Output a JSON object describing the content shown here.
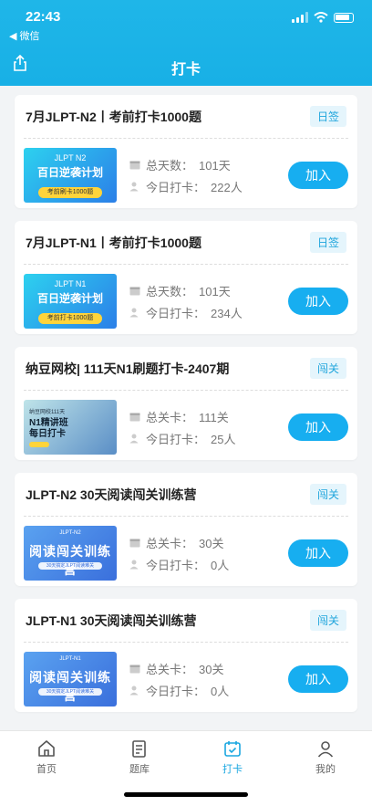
{
  "status_bar": {
    "time": "22:43",
    "back_app": "◀ 微信"
  },
  "header": {
    "title": "打卡"
  },
  "cards": [
    {
      "title": "7月JLPT-N2丨考前打卡1000题",
      "tag": "日签",
      "stat1_label": "总天数：",
      "stat1_value": "101天",
      "stat2_label": "今日打卡：",
      "stat2_value": "222人",
      "thumb": {
        "line1": "JLPT N2",
        "line2": "百日逆袭计划",
        "pill": "考前刷卡1000题"
      },
      "join": "加入"
    },
    {
      "title": "7月JLPT-N1丨考前打卡1000题",
      "tag": "日签",
      "stat1_label": "总天数：",
      "stat1_value": "101天",
      "stat2_label": "今日打卡：",
      "stat2_value": "234人",
      "thumb": {
        "line1": "JLPT N1",
        "line2": "百日逆袭计划",
        "pill": "考前打卡1000题"
      },
      "join": "加入"
    },
    {
      "title": "纳豆网校| 111天N1刷题打卡-2407期",
      "tag": "闯关",
      "stat1_label": "总关卡：",
      "stat1_value": "111关",
      "stat2_label": "今日打卡：",
      "stat2_value": "25人",
      "thumb": {
        "line1": "纳豆网校111天",
        "line2": "N1精讲班",
        "line3": "每日打卡"
      },
      "join": "加入"
    },
    {
      "title": "JLPT-N2 30天阅读闯关训练营",
      "tag": "闯关",
      "stat1_label": "总关卡：",
      "stat1_value": "30关",
      "stat2_label": "今日打卡：",
      "stat2_value": "0人",
      "thumb": {
        "line1": "JLPT-N2",
        "line2": "阅读闯关训练营",
        "sub": "30天搞定JLPT阅读难关"
      },
      "join": "加入"
    },
    {
      "title": "JLPT-N1 30天阅读闯关训练营",
      "tag": "闯关",
      "stat1_label": "总关卡：",
      "stat1_value": "30关",
      "stat2_label": "今日打卡：",
      "stat2_value": "0人",
      "thumb": {
        "line1": "JLPT-N1",
        "line2": "阅读闯关训练营",
        "sub": "30天搞定JLPT阅读难关"
      },
      "join": "加入"
    }
  ],
  "tabbar": [
    {
      "label": "首页",
      "icon": "home-icon"
    },
    {
      "label": "题库",
      "icon": "question-bank-icon"
    },
    {
      "label": "打卡",
      "icon": "checkin-icon"
    },
    {
      "label": "我的",
      "icon": "profile-icon"
    }
  ],
  "colors": {
    "accent": "#17aef0",
    "header": "#1fb6e8"
  }
}
